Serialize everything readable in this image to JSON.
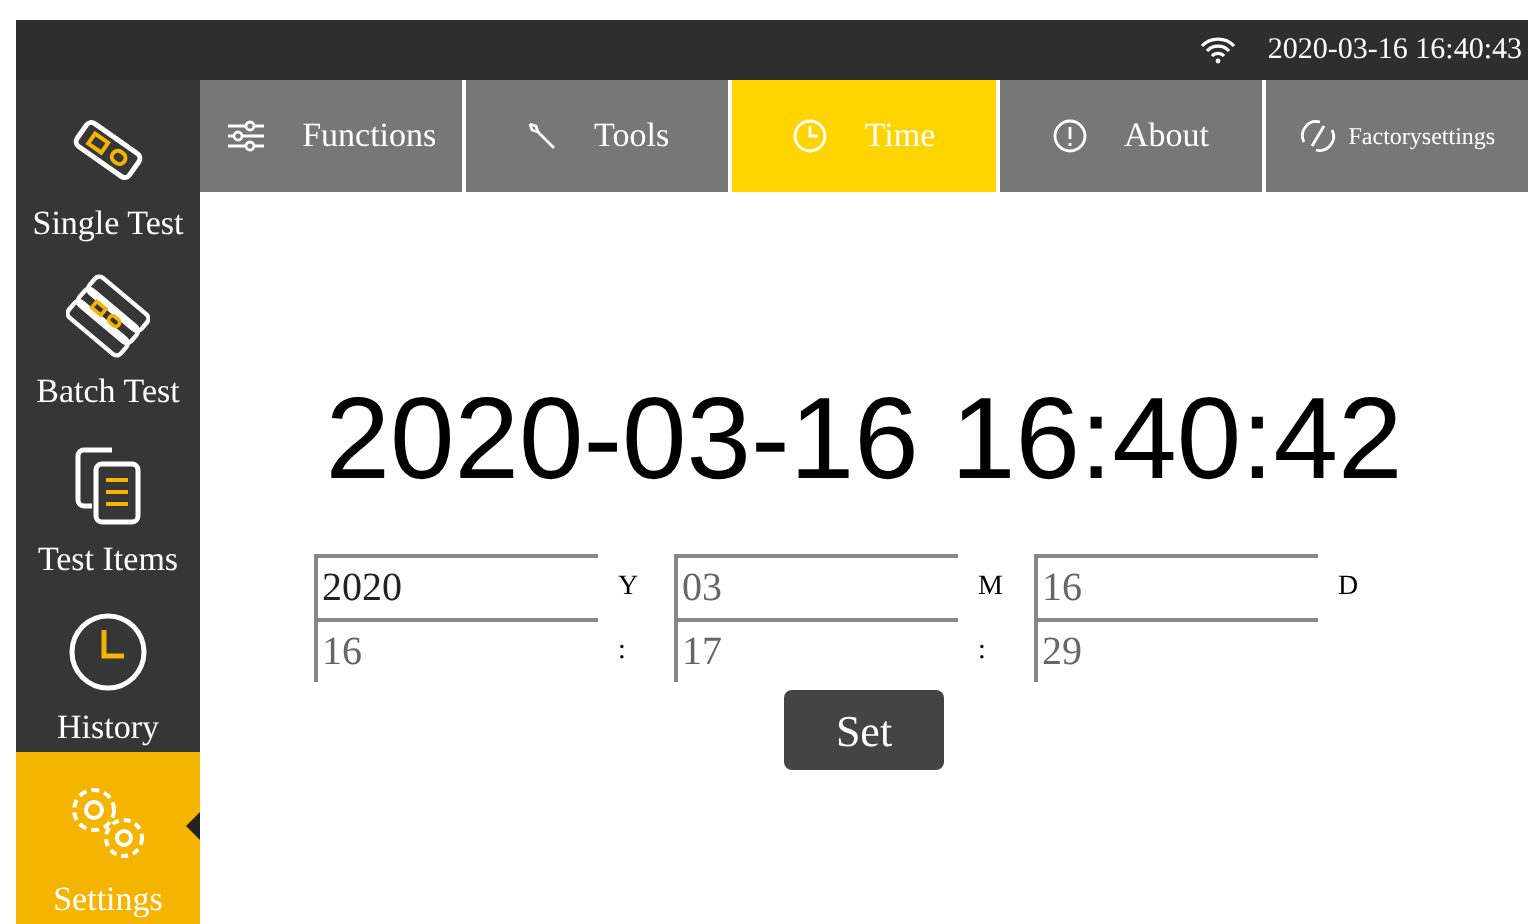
{
  "status_bar": {
    "clock": "2020-03-16 16:40:43"
  },
  "sidebar": {
    "items": [
      {
        "kind": "single",
        "label": "Single Test",
        "selected": false
      },
      {
        "kind": "batch",
        "label": "Batch Test",
        "selected": false
      },
      {
        "kind": "items",
        "label": "Test Items",
        "selected": false
      },
      {
        "kind": "history",
        "label": "History",
        "selected": false
      },
      {
        "kind": "settings",
        "label": "Settings",
        "selected": true
      }
    ]
  },
  "tabs": [
    {
      "kind": "functions",
      "label": "Functions",
      "selected": false
    },
    {
      "kind": "tools",
      "label": "Tools",
      "selected": false
    },
    {
      "kind": "time",
      "label": "Time",
      "selected": true
    },
    {
      "kind": "about",
      "label": "About",
      "selected": false
    },
    {
      "kind": "factory",
      "label": "Factorysettings",
      "selected": false
    }
  ],
  "current_time": "2020-03-16 16:40:42",
  "date_fields": [
    {
      "value": "2020",
      "unit": "Y"
    },
    {
      "placeholder": "03",
      "unit": "M"
    },
    {
      "placeholder": "16",
      "unit": "D"
    }
  ],
  "time_fields": [
    {
      "placeholder": "16",
      "unit": ":"
    },
    {
      "placeholder": "17",
      "unit": ":"
    },
    {
      "placeholder": "29"
    }
  ],
  "set_button": "Set"
}
